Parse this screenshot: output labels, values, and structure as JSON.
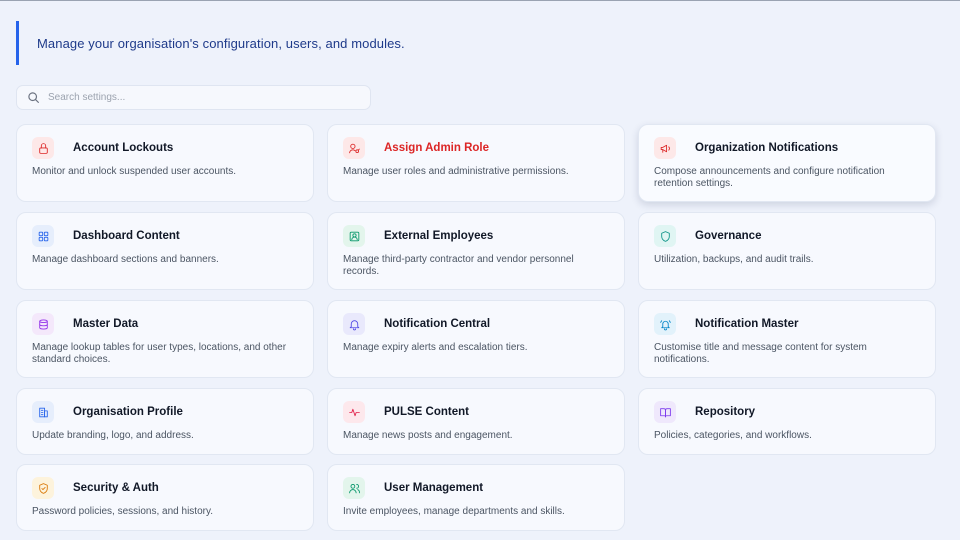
{
  "header": {
    "subtitle": "Manage your organisation's configuration, users, and modules."
  },
  "search": {
    "placeholder": "Search settings..."
  },
  "colors": {
    "accent": "#2563eb",
    "danger": "#dc2626"
  },
  "cards": [
    {
      "title": "Account Lockouts",
      "desc": "Monitor and unlock suspended user accounts.",
      "icon": "lock-icon"
    },
    {
      "title": "Assign Admin Role",
      "desc": "Manage user roles and administrative permissions.",
      "icon": "user-key-icon"
    },
    {
      "title": "Organization Notifications",
      "desc": "Compose announcements and configure notification retention settings.",
      "icon": "megaphone-icon"
    },
    {
      "title": "Dashboard Content",
      "desc": "Manage dashboard sections and banners.",
      "icon": "grid-icon"
    },
    {
      "title": "External Employees",
      "desc": "Manage third-party contractor and vendor personnel records.",
      "icon": "id-card-icon"
    },
    {
      "title": "Governance",
      "desc": "Utilization, backups, and audit trails.",
      "icon": "shield-icon"
    },
    {
      "title": "Master Data",
      "desc": "Manage lookup tables for user types, locations, and other standard choices.",
      "icon": "database-icon"
    },
    {
      "title": "Notification Central",
      "desc": "Manage expiry alerts and escalation tiers.",
      "icon": "bell-icon"
    },
    {
      "title": "Notification Master",
      "desc": "Customise title and message content for system notifications.",
      "icon": "bell-ring-icon"
    },
    {
      "title": "Organisation Profile",
      "desc": "Update branding, logo, and address.",
      "icon": "building-icon"
    },
    {
      "title": "PULSE Content",
      "desc": "Manage news posts and engagement.",
      "icon": "pulse-icon"
    },
    {
      "title": "Repository",
      "desc": "Policies, categories, and workflows.",
      "icon": "book-icon"
    },
    {
      "title": "Security & Auth",
      "desc": "Password policies, sessions, and history.",
      "icon": "shield-check-icon"
    },
    {
      "title": "User Management",
      "desc": "Invite employees, manage departments and skills.",
      "icon": "users-icon"
    }
  ]
}
